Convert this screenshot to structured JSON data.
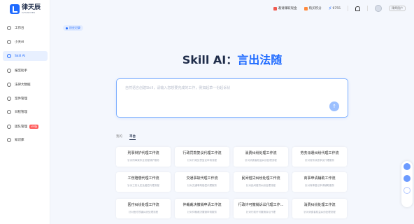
{
  "brand": {
    "name": "律天辰",
    "sub": "LVTIANCHEN"
  },
  "sidebar": {
    "items": [
      {
        "label": "工作台"
      },
      {
        "label": "小天AI"
      },
      {
        "label": "Skill AI"
      },
      {
        "label": "报案助手"
      },
      {
        "label": "法律大数据"
      },
      {
        "label": "案件管理"
      },
      {
        "label": "日程管理"
      },
      {
        "label": "团队管理",
        "badge": "VIP版"
      },
      {
        "label": "知识库"
      }
    ],
    "active_index": 2
  },
  "topbar": {
    "invite": "邀请赚取现金",
    "buy": "购买积分",
    "points": "9755",
    "user": "律师用户"
  },
  "back_tag": "历史记录",
  "hero": {
    "prefix": "Skill AI：",
    "accent": "言出法随"
  },
  "input": {
    "placeholder": "自然语言创建Skill，请输入您想要完成的工作，例如起草一份起诉状"
  },
  "tabs": [
    {
      "label": "我的"
    },
    {
      "label": "平台"
    }
  ],
  "cards": [
    {
      "title": "刑事辩护代理工作流",
      "desc": "针对刑事案件全流程辩护服务"
    },
    {
      "title": "行政罚款复议代理工作流",
      "desc": "针对行政处罚复议申请流程"
    },
    {
      "title": "消费纠纷处理工作流",
      "desc": "针对消费者权益纠纷处理流程"
    },
    {
      "title": "劳务派遣纠纷代理工作流",
      "desc": "针对劳务派遣争议代理服务"
    },
    {
      "title": "工伤赔偿代理工作流",
      "desc": "针对工伤认定及赔偿代理流程"
    },
    {
      "title": "交通事故代理工作流",
      "desc": "针对交通事故赔偿代理服务"
    },
    {
      "title": "民间借贷纠纷处理工作流",
      "desc": "针对民间借贷纠纷处理流程"
    },
    {
      "title": "商事申请辅助工作流",
      "desc": "针对商事登记申请辅助服务"
    },
    {
      "title": "医疗纠纷处理工作流",
      "desc": "针对医疗损害纠纷处理流程"
    },
    {
      "title": "仲裁裁决撤销申请工作流",
      "desc": "针对仲裁裁决撤销申请服务"
    },
    {
      "title": "行政许可撤销诉讼代理工作...",
      "desc": "针对行政许可撤销诉讼代理"
    },
    {
      "title": "消费纠纷处理工作流",
      "desc": "针对消费者权益纠纷处理流程"
    }
  ]
}
